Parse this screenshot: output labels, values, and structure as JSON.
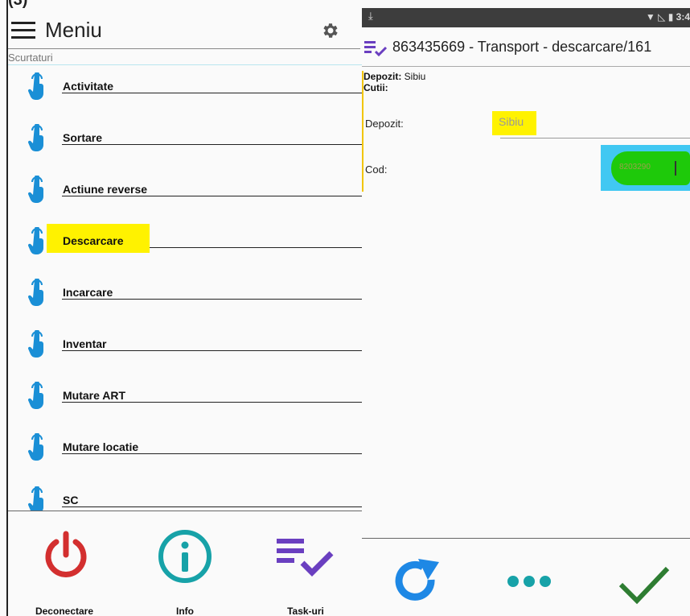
{
  "top_fragment": "(3)",
  "left": {
    "title": "Meniu",
    "section_label": "Scurtaturi",
    "items": [
      {
        "label": "Activitate"
      },
      {
        "label": "Sortare"
      },
      {
        "label": "Actiune reverse"
      },
      {
        "label": "Descarcare",
        "highlighted": true
      },
      {
        "label": "Incarcare"
      },
      {
        "label": "Inventar"
      },
      {
        "label": "Mutare ART"
      },
      {
        "label": "Mutare locatie"
      },
      {
        "label": "SC"
      }
    ],
    "bottom_actions": [
      {
        "label": "Deconectare",
        "icon": "power-icon",
        "color": "#d32f2f"
      },
      {
        "label": "Info",
        "icon": "info-icon",
        "color": "#17a2a8"
      },
      {
        "label": "Task-uri",
        "icon": "task-list-icon",
        "color": "#6a3fc0"
      }
    ],
    "highlight_color": "#fff200",
    "hand_icon_color": "#1a8fd6"
  },
  "right": {
    "status": {
      "time": "3:4"
    },
    "task_title": "863435669 - Transport - descarcare/161",
    "info": {
      "depozit_label": "Depozit:",
      "depozit_value": "Sibiu",
      "cutii_label": "Cutii:"
    },
    "fields": {
      "depozit_label": "Depozit:",
      "depozit_value": "Sibiu",
      "cod_label": "Cod:",
      "cod_value": "8203290"
    },
    "actions": [
      {
        "icon": "refresh-icon",
        "color": "#1e88e5"
      },
      {
        "icon": "more-dots-icon",
        "color": "#17a2a8"
      },
      {
        "icon": "checkmark-icon",
        "color": "#2e7d32"
      }
    ],
    "accent_purple": "#6a3fc0"
  }
}
